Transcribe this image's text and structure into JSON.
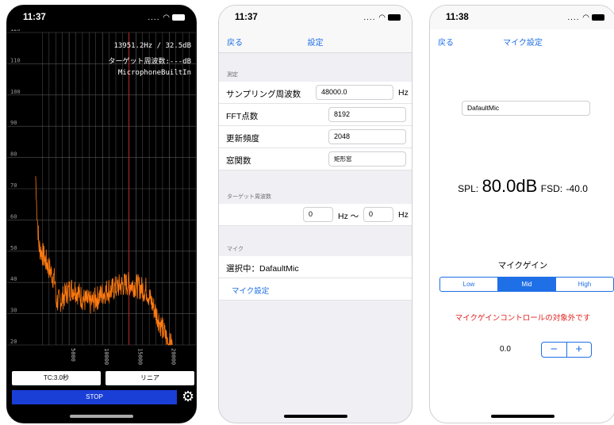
{
  "analyzer": {
    "status_time": "11:37",
    "status_icons": "....",
    "info_freq": "13951.2Hz /  32.5dB",
    "info_target": "ターゲット周波数:---dB",
    "info_mic": "MicrophoneBuiltIn",
    "y_ticks": [
      "120",
      "110",
      "100",
      "90",
      "80",
      "70",
      "60",
      "50",
      "40",
      "30",
      "20"
    ],
    "x_ticks": [
      "5000",
      "10000",
      "15000",
      "20000"
    ],
    "tc_button": "TC:3.0秒",
    "scale_button": "リニア",
    "stop_button": "STOP",
    "gear_icon": "gear-icon",
    "colors": {
      "trace": "#ff7a10",
      "marker": "#d42222",
      "grid": "#555555",
      "stop": "#1a3fd6"
    }
  },
  "settings": {
    "status_time": "11:37",
    "back": "戻る",
    "title": "設定",
    "measure_header": "測定",
    "sampling_label": "サンプリング周波数",
    "sampling_value": "48000.0",
    "sampling_unit": "Hz",
    "fft_label": "FFT点数",
    "fft_value": "8192",
    "update_label": "更新頻度",
    "update_value": "2048",
    "window_label": "窓関数",
    "window_value": "矩形窓",
    "target_header": "ターゲット周波数",
    "target_from": "0",
    "target_mid": "Hz 〜",
    "target_to": "0",
    "target_unit": "Hz",
    "mic_header": "マイク",
    "mic_selected": "選択中：DafaultMic",
    "mic_settings_link": "マイク設定"
  },
  "mic": {
    "status_time": "11:38",
    "back": "戻る",
    "title": "マイク設定",
    "mic_name": "DafaultMic",
    "spl_label": "SPL:",
    "spl_value": "80.0dB",
    "fsd_label": "FSD:",
    "fsd_value": "-40.0",
    "gain_title": "マイクゲイン",
    "gain_options": [
      "Low",
      "Mid",
      "High"
    ],
    "gain_selected": "Mid",
    "warning": "マイクゲインコントロールの対象外です",
    "gain_value": "0.0",
    "minus": "−",
    "plus": "+",
    "accent": "#1f6fe6",
    "warning_color": "#e0211e"
  }
}
